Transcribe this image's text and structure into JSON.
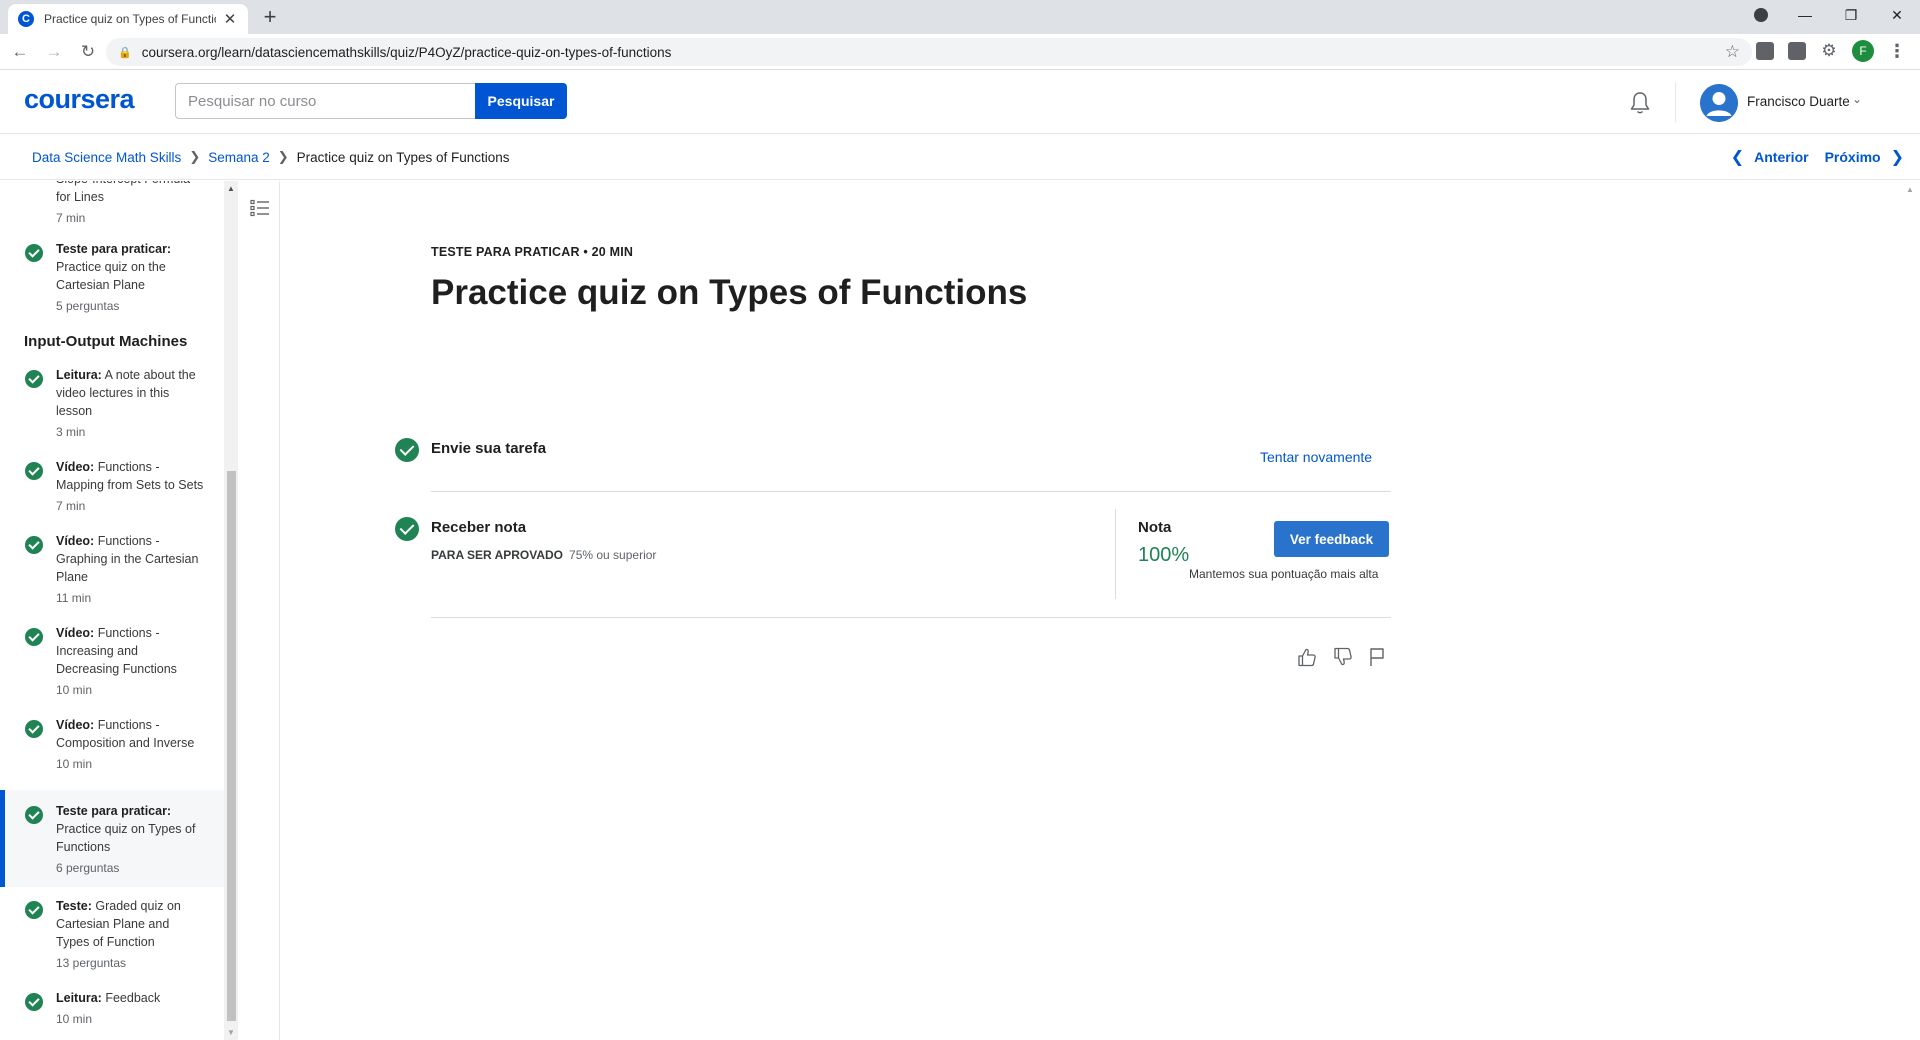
{
  "browser": {
    "tab_title": "Practice quiz on Types of Functions | Coursera",
    "tab_favicon_letter": "C",
    "new_tab": "+",
    "close_tab": "✕",
    "url": "coursera.org/learn/datasciencemathskills/quiz/P4OyZ/practice-quiz-on-types-of-functions",
    "profile_initial": "F"
  },
  "header": {
    "logo": "coursera",
    "search_placeholder": "Pesquisar no curso",
    "search_button": "Pesquisar",
    "user_name": "Francisco Duarte"
  },
  "breadcrumb": {
    "items": [
      "Data Science Math Skills",
      "Semana 2"
    ],
    "current": "Practice quiz on Types of Functions",
    "prev": "Anterior",
    "next": "Próximo"
  },
  "sidebar": {
    "partial_item": {
      "title": "Slope-Intercept Formula for Lines",
      "meta": "7 min"
    },
    "items_before": [
      {
        "type": "Teste para praticar:",
        "title": "Practice quiz on the Cartesian Plane",
        "meta": "5 perguntas"
      }
    ],
    "section": "Input-Output Machines",
    "items": [
      {
        "type": "Leitura:",
        "title": "A note about the video lectures in this lesson",
        "meta": "3 min"
      },
      {
        "type": "Vídeo:",
        "title": "Functions - Mapping from Sets to Sets",
        "meta": "7 min"
      },
      {
        "type": "Vídeo:",
        "title": "Functions - Graphing in the Cartesian Plane",
        "meta": "11 min"
      },
      {
        "type": "Vídeo:",
        "title": "Functions - Increasing and Decreasing Functions",
        "meta": "10 min"
      },
      {
        "type": "Vídeo:",
        "title": "Functions - Composition and Inverse",
        "meta": "10 min"
      },
      {
        "type": "Teste para praticar:",
        "title": "Practice quiz on Types of Functions",
        "meta": "6 perguntas"
      },
      {
        "type": "Teste:",
        "title": "Graded quiz on Cartesian Plane and Types of Function",
        "meta": "13 perguntas"
      },
      {
        "type": "Leitura:",
        "title": "Feedback",
        "meta": "10 min"
      }
    ]
  },
  "main": {
    "kicker": "TESTE PARA PRATICAR • 20 MIN",
    "title": "Practice quiz on Types of Functions",
    "step1_label": "Envie sua tarefa",
    "retry": "Tentar novamente",
    "step2_label": "Receber nota",
    "pass_label": "PARA SER APROVADO",
    "pass_value": "75% ou superior",
    "grade_label": "Nota",
    "grade_value": "100%",
    "feedback_button": "Ver feedback",
    "grade_note": "Mantemos sua pontuação mais alta"
  },
  "colors": {
    "brand": "#0056d2",
    "success": "#1f8354",
    "button": "#2a73cc"
  }
}
